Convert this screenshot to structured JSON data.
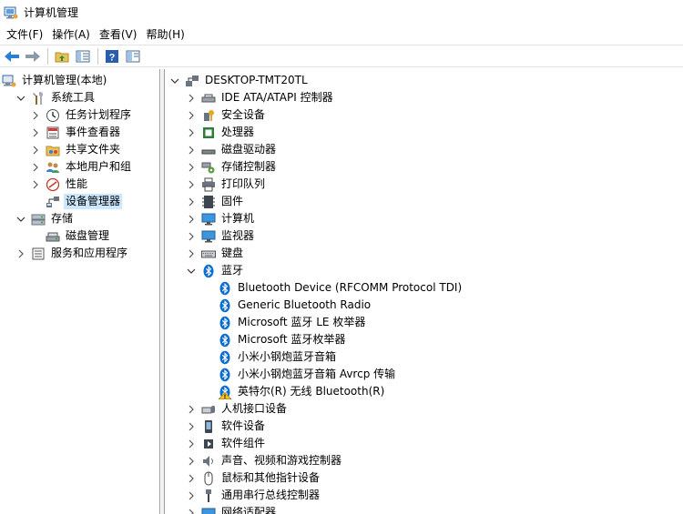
{
  "window": {
    "title": "计算机管理"
  },
  "menu": [
    "文件(F)",
    "操作(A)",
    "查看(V)",
    "帮助(H)"
  ],
  "left_tree": [
    {
      "label": "计算机管理(本地)",
      "icon": "computer-management-icon",
      "level": 0,
      "expander": "none"
    },
    {
      "label": "系统工具",
      "icon": "system-tools-icon",
      "level": 1,
      "expander": "expanded"
    },
    {
      "label": "任务计划程序",
      "icon": "task-scheduler-icon",
      "level": 2,
      "expander": "collapsed"
    },
    {
      "label": "事件查看器",
      "icon": "event-viewer-icon",
      "level": 2,
      "expander": "collapsed"
    },
    {
      "label": "共享文件夹",
      "icon": "shared-folder-icon",
      "level": 2,
      "expander": "collapsed"
    },
    {
      "label": "本地用户和组",
      "icon": "users-icon",
      "level": 2,
      "expander": "collapsed"
    },
    {
      "label": "性能",
      "icon": "performance-icon",
      "level": 2,
      "expander": "collapsed"
    },
    {
      "label": "设备管理器",
      "icon": "device-manager-icon",
      "level": 2,
      "expander": "none",
      "selected": true
    },
    {
      "label": "存储",
      "icon": "storage-icon",
      "level": 1,
      "expander": "expanded"
    },
    {
      "label": "磁盘管理",
      "icon": "disk-management-icon",
      "level": 2,
      "expander": "none"
    },
    {
      "label": "服务和应用程序",
      "icon": "services-icon",
      "level": 1,
      "expander": "collapsed"
    }
  ],
  "right_tree": [
    {
      "label": "DESKTOP-TMT20TL",
      "icon": "computer-root-icon",
      "level": 0,
      "expander": "expanded"
    },
    {
      "label": "IDE ATA/ATAPI 控制器",
      "icon": "ide-controller-icon",
      "level": 1,
      "expander": "collapsed"
    },
    {
      "label": "安全设备",
      "icon": "security-device-icon",
      "level": 1,
      "expander": "collapsed"
    },
    {
      "label": "处理器",
      "icon": "processor-icon",
      "level": 1,
      "expander": "collapsed"
    },
    {
      "label": "磁盘驱动器",
      "icon": "disk-drive-icon",
      "level": 1,
      "expander": "collapsed"
    },
    {
      "label": "存储控制器",
      "icon": "storage-controller-icon",
      "level": 1,
      "expander": "collapsed"
    },
    {
      "label": "打印队列",
      "icon": "printer-icon",
      "level": 1,
      "expander": "collapsed"
    },
    {
      "label": "固件",
      "icon": "firmware-icon",
      "level": 1,
      "expander": "collapsed"
    },
    {
      "label": "计算机",
      "icon": "monitor-icon",
      "level": 1,
      "expander": "collapsed"
    },
    {
      "label": "监视器",
      "icon": "monitor-icon",
      "level": 1,
      "expander": "collapsed"
    },
    {
      "label": "键盘",
      "icon": "keyboard-icon",
      "level": 1,
      "expander": "collapsed"
    },
    {
      "label": "蓝牙",
      "icon": "bluetooth-icon",
      "level": 1,
      "expander": "expanded"
    },
    {
      "label": "Bluetooth Device (RFCOMM Protocol TDI)",
      "icon": "bluetooth-icon",
      "level": 2,
      "expander": "none"
    },
    {
      "label": "Generic Bluetooth Radio",
      "icon": "bluetooth-icon",
      "level": 2,
      "expander": "none"
    },
    {
      "label": "Microsoft 蓝牙 LE 枚举器",
      "icon": "bluetooth-icon",
      "level": 2,
      "expander": "none"
    },
    {
      "label": "Microsoft 蓝牙枚举器",
      "icon": "bluetooth-icon",
      "level": 2,
      "expander": "none"
    },
    {
      "label": "小米小钢炮蓝牙音箱",
      "icon": "bluetooth-icon",
      "level": 2,
      "expander": "none"
    },
    {
      "label": "小米小钢炮蓝牙音箱 Avrcp 传输",
      "icon": "bluetooth-icon",
      "level": 2,
      "expander": "none"
    },
    {
      "label": "英特尔(R) 无线 Bluetooth(R)",
      "icon": "bluetooth-warning-icon",
      "level": 2,
      "expander": "none"
    },
    {
      "label": "人机接口设备",
      "icon": "hid-icon",
      "level": 1,
      "expander": "collapsed"
    },
    {
      "label": "软件设备",
      "icon": "software-device-icon",
      "level": 1,
      "expander": "collapsed"
    },
    {
      "label": "软件组件",
      "icon": "software-component-icon",
      "level": 1,
      "expander": "collapsed"
    },
    {
      "label": "声音、视频和游戏控制器",
      "icon": "sound-icon",
      "level": 1,
      "expander": "collapsed"
    },
    {
      "label": "鼠标和其他指针设备",
      "icon": "mouse-icon",
      "level": 1,
      "expander": "collapsed"
    },
    {
      "label": "通用串行总线控制器",
      "icon": "usb-icon",
      "level": 1,
      "expander": "collapsed"
    },
    {
      "label": "网络适配器",
      "icon": "network-adapter-icon",
      "level": 1,
      "expander": "collapsed"
    }
  ],
  "colors": {
    "selection": "#cce8ff",
    "bluetooth": "#0a6ed1",
    "warning": "#f5c518"
  }
}
